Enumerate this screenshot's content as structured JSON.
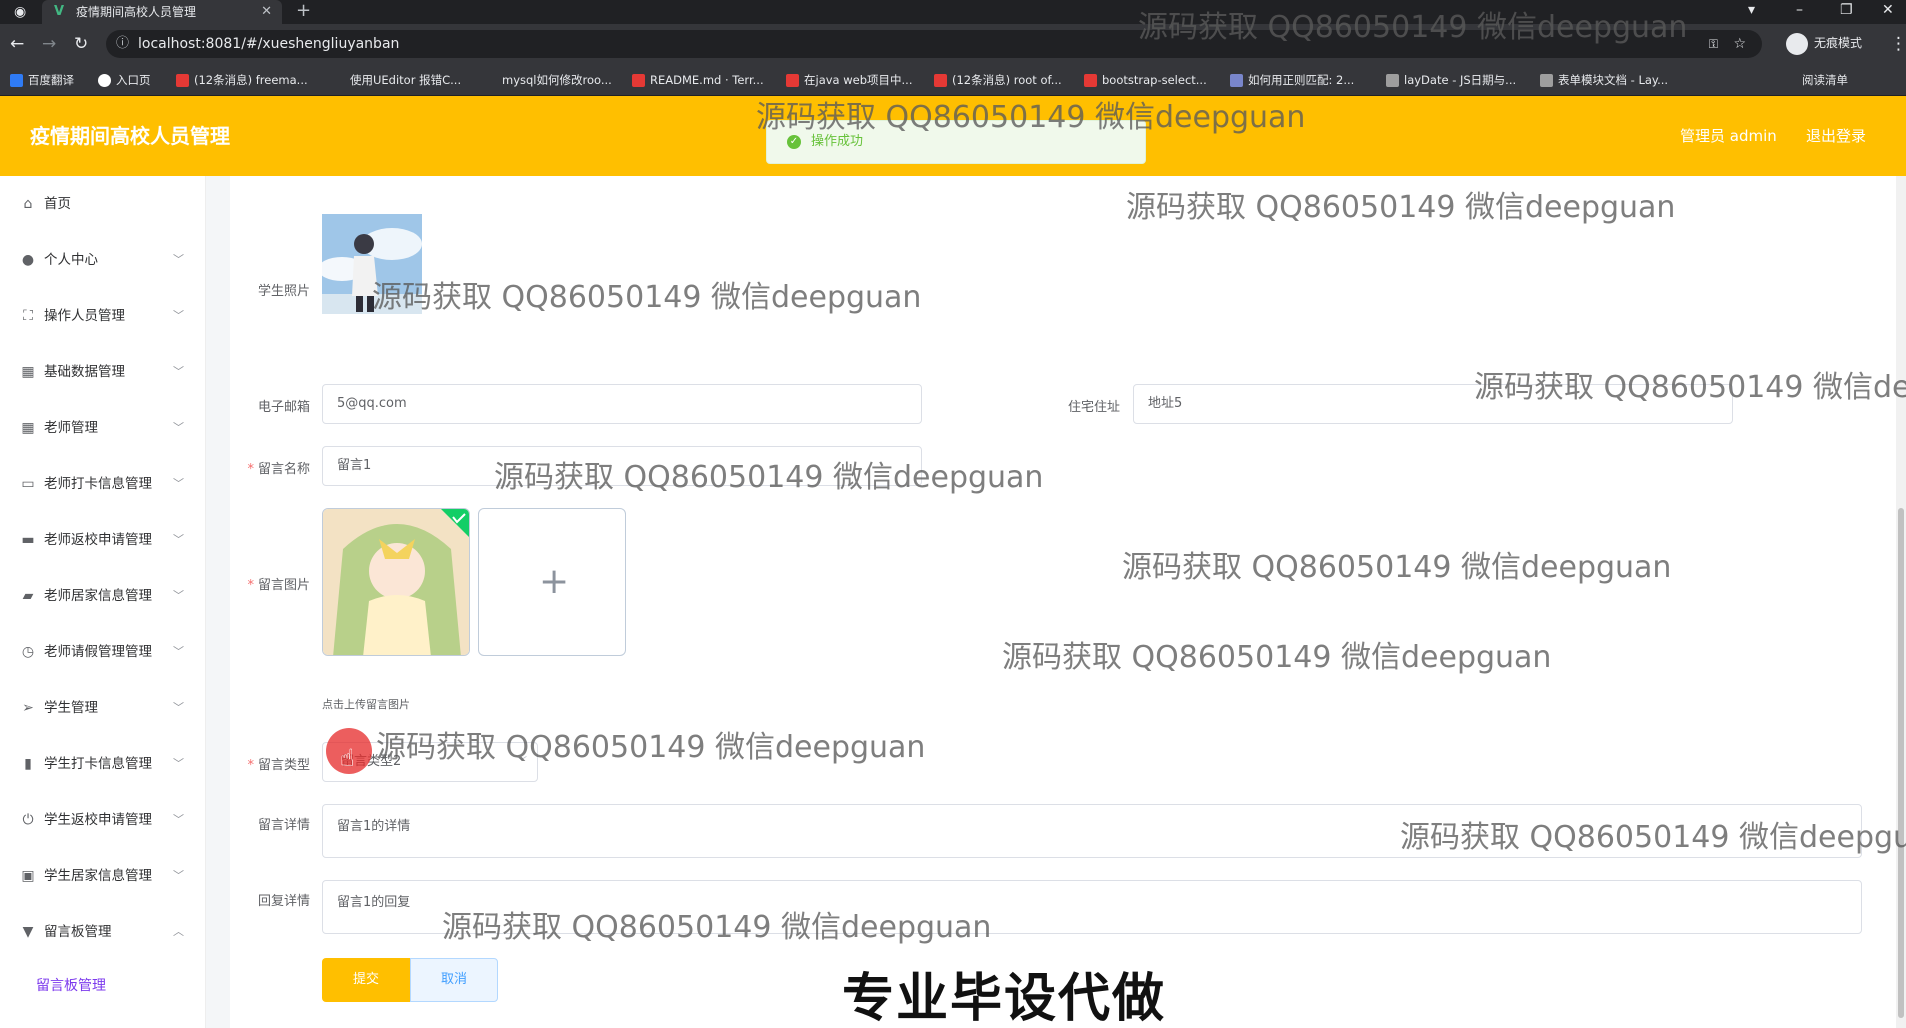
{
  "browser": {
    "tab_title": "疫情期间高校人员管理",
    "url": "localhost:8081/#/xueshengliuyanban",
    "incognito_label": "无痕模式",
    "reading_list": "阅读清单",
    "bookmarks": [
      "百度翻译",
      "入口页",
      "(12条消息) freema...",
      "使用UEditor 报错C...",
      "mysql如何修改roo...",
      "README.md · Terr...",
      "在java web项目中...",
      "(12条消息) root of...",
      "bootstrap-select...",
      "如何用正则匹配: 2...",
      "layDate - JS日期与...",
      "表单模块文档 - Lay..."
    ]
  },
  "header": {
    "title": "疫情期间高校人员管理",
    "user": "管理员 admin",
    "logout": "退出登录"
  },
  "toast": {
    "text": "操作成功"
  },
  "sidebar": {
    "items": [
      {
        "label": "首页",
        "icon": "home-icon"
      },
      {
        "label": "个人中心",
        "icon": "user-icon"
      },
      {
        "label": "操作人员管理",
        "icon": "frame-icon"
      },
      {
        "label": "基础数据管理",
        "icon": "grid-icon"
      },
      {
        "label": "老师管理",
        "icon": "apps-icon"
      },
      {
        "label": "老师打卡信息管理",
        "icon": "message-icon"
      },
      {
        "label": "老师返校申请管理",
        "icon": "wallet-icon"
      },
      {
        "label": "老师居家信息管理",
        "icon": "briefcase-icon"
      },
      {
        "label": "老师请假管理管理",
        "icon": "clock-icon"
      },
      {
        "label": "学生管理",
        "icon": "send-icon"
      },
      {
        "label": "学生打卡信息管理",
        "icon": "bar-chart-icon"
      },
      {
        "label": "学生返校申请管理",
        "icon": "power-icon"
      },
      {
        "label": "学生居家信息管理",
        "icon": "calendar-icon"
      },
      {
        "label": "留言板管理",
        "icon": "cup-icon"
      }
    ],
    "sub_item": "留言板管理"
  },
  "form": {
    "photo_label": "学生照片",
    "email_label": "电子邮箱",
    "email_value": "5@qq.com",
    "address_label": "住宅住址",
    "address_value": "地址5",
    "msg_name_label": "留言名称",
    "msg_name_value": "留言1",
    "msg_image_label": "留言图片",
    "upload_tip": "点击上传留言图片",
    "msg_type_label": "留言类型",
    "msg_type_value": "留言类型2",
    "msg_detail_label": "留言详情",
    "msg_detail_value": "留言1的详情",
    "reply_label": "回复详情",
    "reply_value": "留言1的回复",
    "submit": "提交",
    "cancel": "取消"
  },
  "overlay": {
    "watermark": "源码获取 QQ86050149 微信deepguan",
    "banner": "专业毕设代做"
  }
}
